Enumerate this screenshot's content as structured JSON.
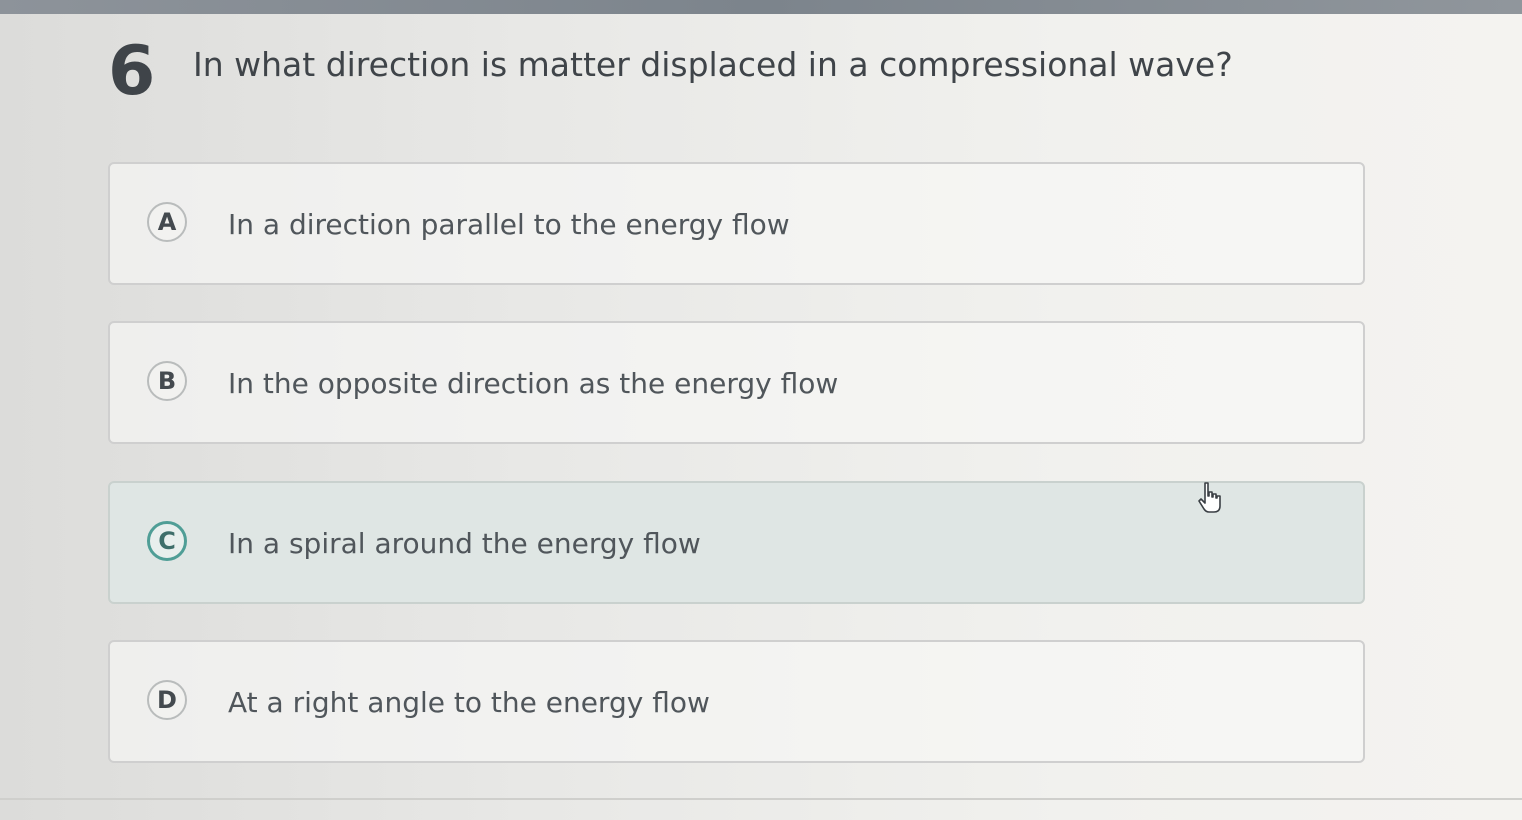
{
  "question": {
    "number": "6",
    "text": "In what direction is matter displaced in a compressional wave?"
  },
  "options": [
    {
      "letter": "A",
      "text": "In a direction parallel to the energy flow",
      "selected": false
    },
    {
      "letter": "B",
      "text": "In the opposite direction as the energy flow",
      "selected": false
    },
    {
      "letter": "C",
      "text": "In a spiral around the energy flow",
      "selected": true
    },
    {
      "letter": "D",
      "text": "At a right angle to the energy flow",
      "selected": false
    }
  ],
  "cursor": {
    "icon": "hand-pointer-icon"
  },
  "colors": {
    "selected_accent": "#4f9e96",
    "selected_background": "#dfe6e4"
  }
}
